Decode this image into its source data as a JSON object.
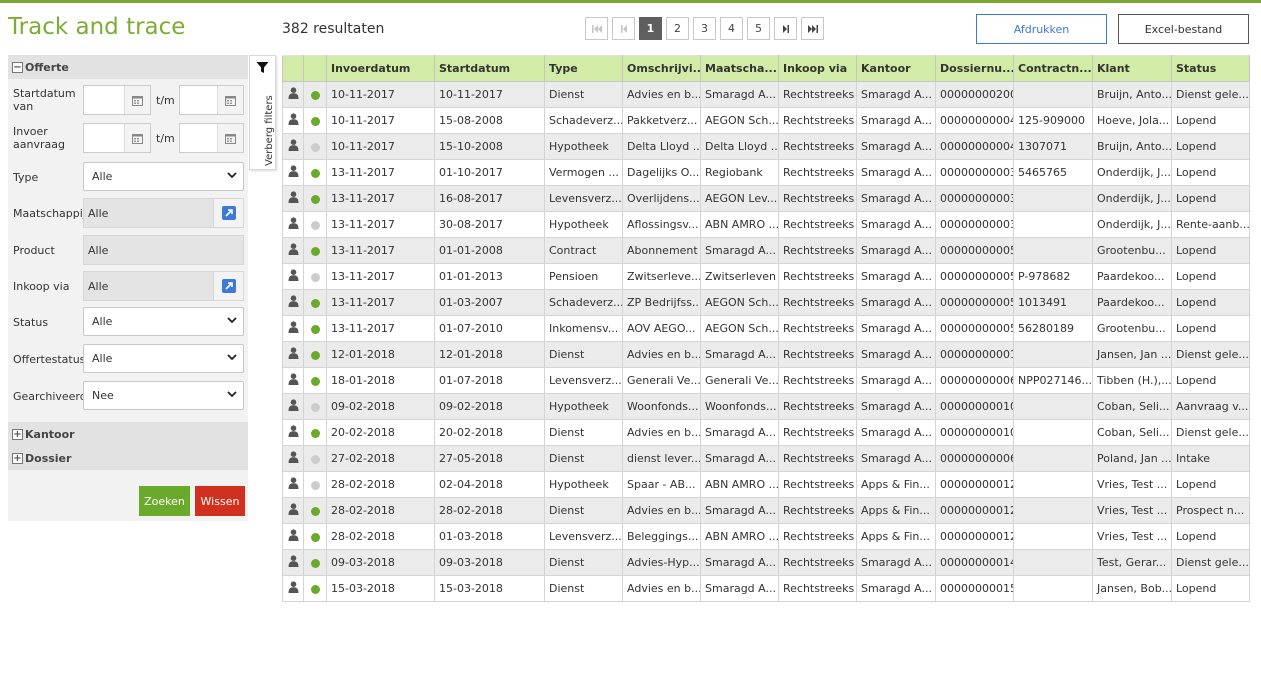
{
  "app": {
    "title": "Track and trace"
  },
  "results_label": "382 resultaten",
  "pagination": {
    "pages": [
      "1",
      "2",
      "3",
      "4",
      "5"
    ],
    "active": "1"
  },
  "actions": {
    "print_label": "Afdrukken",
    "excel_label": "Excel-bestand"
  },
  "filters": {
    "offerte_section": "Offerte",
    "startdatum_label_1": "Startdatum",
    "startdatum_label_2": "van",
    "invoer_label_1": "Invoer",
    "invoer_label_2": "aanvraag",
    "tm_label": "t/m",
    "type_label": "Type",
    "type_value": "Alle",
    "maatschappij_label": "Maatschappij",
    "maatschappij_value": "Alle",
    "product_label": "Product",
    "product_value": "Alle",
    "inkoop_label": "Inkoop via",
    "inkoop_value": "Alle",
    "status_label": "Status",
    "status_value": "Alle",
    "offertestatus_label": "Offertestatus",
    "offertestatus_value": "Alle",
    "gearchiveerd_label": "Gearchiveerd",
    "gearchiveerd_value": "Nee",
    "kantoor_section": "Kantoor",
    "dossier_section": "Dossier",
    "search_label": "Zoeken",
    "clear_label": "Wissen"
  },
  "hide_filters_label": "Verberg filters",
  "colors": {
    "active": "#6aaa2a",
    "inactive": "#cccccc",
    "header_bg": "#d2eca8",
    "accent_green": "#7dac34",
    "print_blue": "#3d7ad6",
    "clear_red": "#d0301d"
  },
  "table": {
    "columns": [
      "Invoerdatum",
      "Startdatum",
      "Type",
      "Omschrijvi...",
      "Maatscha...",
      "Inkoop via",
      "Kantoor",
      "Dossiernu...",
      "Contractn...",
      "Klant",
      "Status"
    ],
    "rows": [
      {
        "active": true,
        "cells": [
          "10-11-2017",
          "10-11-2017",
          "Dienst",
          "Advies en b...",
          "Smaragd A...",
          "Rechtstreeks",
          "Smaragd A...",
          "00000000200",
          "",
          "Bruijn, Anto...",
          "Dienst gele..."
        ]
      },
      {
        "active": true,
        "cells": [
          "10-11-2017",
          "15-08-2008",
          "Schadeverz...",
          "Pakketverz...",
          "AEGON Sch...",
          "Rechtstreeks",
          "Smaragd A...",
          "00000000004",
          "125-909000",
          "Hoeve, Jola...",
          "Lopend"
        ]
      },
      {
        "active": false,
        "cells": [
          "10-11-2017",
          "15-10-2008",
          "Hypotheek",
          "Delta Lloyd ...",
          "Delta Lloyd ...",
          "Rechtstreeks",
          "Smaragd A...",
          "00000000004",
          "1307071",
          "Bruijn, Anto...",
          "Lopend"
        ]
      },
      {
        "active": true,
        "cells": [
          "13-11-2017",
          "01-10-2017",
          "Vermogen ...",
          "Dagelijks O...",
          "Regiobank",
          "Rechtstreeks",
          "Smaragd A...",
          "00000000003",
          "5465765",
          "Onderdijk, J...",
          "Lopend"
        ]
      },
      {
        "active": true,
        "cells": [
          "13-11-2017",
          "16-08-2017",
          "Levensverz...",
          "Overlijdens...",
          "AEGON Lev...",
          "Rechtstreeks",
          "Smaragd A...",
          "00000000003",
          "",
          "Onderdijk, J...",
          "Lopend"
        ]
      },
      {
        "active": false,
        "cells": [
          "13-11-2017",
          "30-08-2017",
          "Hypotheek",
          "Aflossingsv...",
          "ABN AMRO ...",
          "Rechtstreeks",
          "Smaragd A...",
          "00000000003",
          "",
          "Onderdijk, J...",
          "Rente-aanb..."
        ]
      },
      {
        "active": true,
        "cells": [
          "13-11-2017",
          "01-01-2008",
          "Contract",
          "Abonnement",
          "Smaragd A...",
          "Rechtstreeks",
          "Smaragd A...",
          "00000000005",
          "",
          "Grootenbu...",
          "Lopend"
        ]
      },
      {
        "active": false,
        "cells": [
          "13-11-2017",
          "01-01-2013",
          "Pensioen",
          "Zwitserleve...",
          "Zwitserleven",
          "Rechtstreeks",
          "Smaragd A...",
          "00000000005",
          "P-978682",
          "Paardekoo...",
          "Lopend"
        ]
      },
      {
        "active": true,
        "cells": [
          "13-11-2017",
          "01-03-2007",
          "Schadeverz...",
          "ZP Bedrijfss...",
          "AEGON Sch...",
          "Rechtstreeks",
          "Smaragd A...",
          "00000000005",
          "1013491",
          "Paardekoo...",
          "Lopend"
        ]
      },
      {
        "active": true,
        "cells": [
          "13-11-2017",
          "01-07-2010",
          "Inkomensv...",
          "AOV AEGO...",
          "AEGON Sch...",
          "Rechtstreeks",
          "Smaragd A...",
          "00000000005",
          "56280189",
          "Grootenbu...",
          "Lopend"
        ]
      },
      {
        "active": true,
        "cells": [
          "12-01-2018",
          "12-01-2018",
          "Dienst",
          "Advies en b...",
          "Smaragd A...",
          "Rechtstreeks",
          "Smaragd A...",
          "00000000001",
          "",
          "Jansen, Jan ...",
          "Dienst gele..."
        ]
      },
      {
        "active": true,
        "cells": [
          "18-01-2018",
          "01-07-2018",
          "Levensverz...",
          "Generali Ve...",
          "Generali Ve...",
          "Rechtstreeks",
          "Smaragd A...",
          "00000000006",
          "NPP027146...",
          "Tibben (H.),...",
          "Lopend"
        ]
      },
      {
        "active": false,
        "cells": [
          "09-02-2018",
          "09-02-2018",
          "Hypotheek",
          "Woonfonds...",
          "Woonfonds...",
          "Rechtstreeks",
          "Smaragd A...",
          "00000000010",
          "",
          "Coban, Seli...",
          "Aanvraag v..."
        ]
      },
      {
        "active": true,
        "cells": [
          "20-02-2018",
          "20-02-2018",
          "Dienst",
          "Advies en b...",
          "Smaragd A...",
          "Rechtstreeks",
          "Smaragd A...",
          "00000000010",
          "",
          "Coban, Seli...",
          "Dienst gele..."
        ]
      },
      {
        "active": false,
        "cells": [
          "27-02-2018",
          "27-05-2018",
          "Dienst",
          "dienst lever...",
          "Smaragd A...",
          "Rechtstreeks",
          "Smaragd A...",
          "00000000006",
          "",
          "Poland, Jan ...",
          "Intake"
        ]
      },
      {
        "active": false,
        "cells": [
          "28-02-2018",
          "02-04-2018",
          "Hypotheek",
          "Spaar - AB...",
          "ABN AMRO ...",
          "Rechtstreeks",
          "Apps & Fin...",
          "00000000012",
          "",
          "Vries, Test ...",
          "Lopend"
        ]
      },
      {
        "active": true,
        "cells": [
          "28-02-2018",
          "28-02-2018",
          "Dienst",
          "Advies en b...",
          "Smaragd A...",
          "Rechtstreeks",
          "Apps & Fin...",
          "00000000012",
          "",
          "Vries, Test ...",
          "Prospect n..."
        ]
      },
      {
        "active": true,
        "cells": [
          "28-02-2018",
          "01-03-2018",
          "Levensverz...",
          "Beleggings...",
          "ABN AMRO ...",
          "Rechtstreeks",
          "Apps & Fin...",
          "00000000012",
          "",
          "Vries, Test ...",
          "Lopend"
        ]
      },
      {
        "active": true,
        "cells": [
          "09-03-2018",
          "09-03-2018",
          "Dienst",
          "Advies-Hyp...",
          "Smaragd A...",
          "Rechtstreeks",
          "Smaragd A...",
          "00000000014",
          "",
          "Test, Gerar...",
          "Dienst gele..."
        ]
      },
      {
        "active": true,
        "cells": [
          "15-03-2018",
          "15-03-2018",
          "Dienst",
          "Advies en b...",
          "Smaragd A...",
          "Rechtstreeks",
          "Smaragd A...",
          "00000000015",
          "",
          "Jansen, Bob...",
          "Lopend"
        ]
      }
    ]
  }
}
